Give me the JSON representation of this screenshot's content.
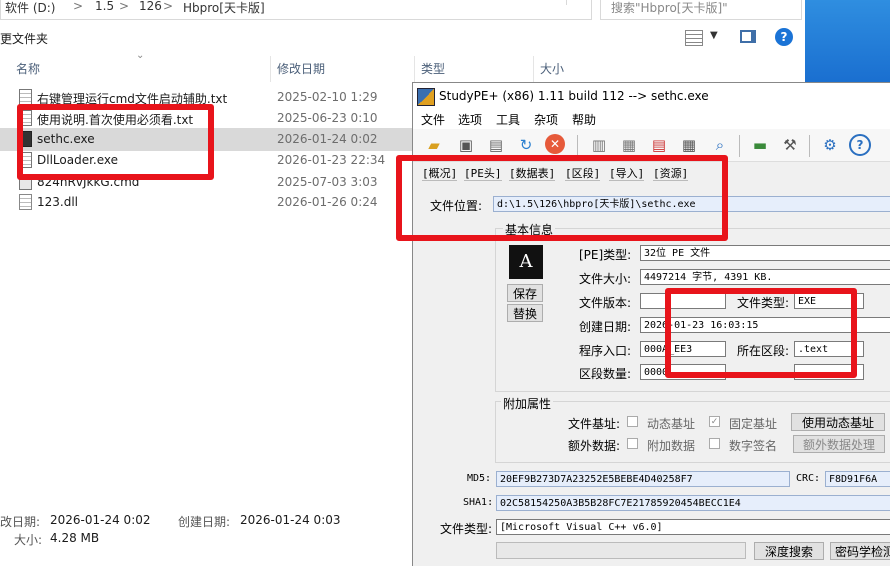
{
  "explorer": {
    "address": {
      "parts": [
        "软件 (D:)",
        "1.5",
        "126",
        "Hbpro[天卡版]"
      ],
      "sep": ">"
    },
    "search_placeholder": "搜索\"Hbpro[天卡版]\"",
    "toolbar_left": "更文件夹",
    "columns": {
      "name": "名称",
      "date": "修改日期",
      "type": "类型",
      "size": "大小"
    },
    "files": [
      {
        "name": "右键管理运行cmd文件启动辅助.txt",
        "date": "2025-02-10 1:29",
        "icon": "text-file-icon"
      },
      {
        "name": "使用说明.首次使用必须看.txt",
        "date": "2025-06-23 0:10",
        "icon": "text-file-icon"
      },
      {
        "name": "sethc.exe",
        "date": "2026-01-24 0:02",
        "icon": "exe-file-icon",
        "selected": true
      },
      {
        "name": "DllLoader.exe",
        "date": "2026-01-23 22:34",
        "icon": "text-file-icon"
      },
      {
        "name": "824nRvJkkG.cmd",
        "date": "2025-07-03 3:03",
        "icon": "cmd-file-icon"
      },
      {
        "name": "123.dll",
        "date": "2026-01-26 0:24",
        "icon": "dll-file-icon"
      }
    ],
    "details": {
      "modified_label": "改日期:",
      "modified_value": "2026-01-24 0:02",
      "created_label": "创建日期:",
      "created_value": "2026-01-24 0:03",
      "size_label": "大小:",
      "size_value": "4.28 MB"
    }
  },
  "studype": {
    "title": "StudyPE+ (x86) 1.11 build 112  --> sethc.exe",
    "menu": [
      "文件",
      "选项",
      "工具",
      "杂项",
      "帮助"
    ],
    "tabs": [
      "[概况]",
      "[PE头]",
      "[数据表]",
      "[区段]",
      "[导入]",
      "[资源]"
    ],
    "file_location_label": "文件位置:",
    "file_location_value": "d:\\1.5\\126\\hbpro[天卡版]\\sethc.exe",
    "basic_info_label": "基本信息",
    "save_button": "保存",
    "replace_button": "替换",
    "pe_type_label": "[PE]类型:",
    "pe_type_value": "32位 PE 文件",
    "file_size_label": "文件大小:",
    "file_size_value": "4497214 字节, 4391 KB.",
    "file_version_label": "文件版本:",
    "file_version_value": "",
    "file_type_label": "文件类型:",
    "file_type_value": "EXE",
    "create_date_label": "创建日期:",
    "create_date_value": "2026-01-23 16:03:15",
    "entry_label": "程序入口:",
    "entry_value": "000A_EE3",
    "section_label": "所在区段:",
    "section_value": ".text",
    "section_count_label": "区段数量:",
    "section_count_value": "0000",
    "extra_attr_label": "附加属性",
    "file_base_label": "文件基址:",
    "dynamic_base_label": "动态基址",
    "fixed_base_label": "固定基址",
    "use_dynamic_base_button": "使用动态基址",
    "extra_data_label": "额外数据:",
    "append_data_label": "附加数据",
    "digital_sign_label": "数字签名",
    "extra_data_process_button": "额外数据处理",
    "md5_label": "MD5:",
    "md5_value": "20EF9B273D7A23252E5BEBE4D40258F7",
    "crc_label": "CRC:",
    "crc_value": "F8D91F6A",
    "sha1_label": "SHA1:",
    "sha1_value": "02C58154250A3B5B28FC7E21785920454BECC1E4",
    "compiler_label": "文件类型:",
    "compiler_value": "[Microsoft Visual C++ v6.0]",
    "deep_search_button": "深度搜索",
    "crypto_detect_button": "密码学检测"
  }
}
